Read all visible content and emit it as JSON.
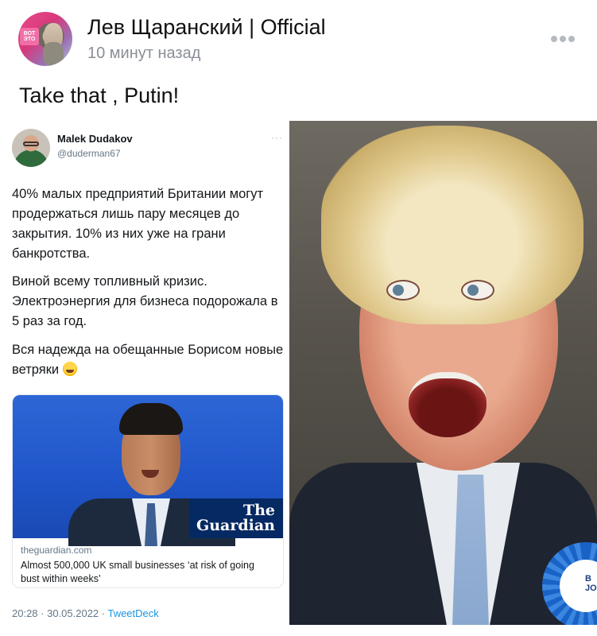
{
  "post": {
    "author": "Лев Щаранский | Official",
    "time": "10 минут назад",
    "text": "Take that , Putin!",
    "avatar_badge": "ВОТ ЭТО",
    "more_icon": "more-horizontal-icon"
  },
  "tweet": {
    "author_name": "Malek Dudakov",
    "author_handle": "@duderman67",
    "more_label": "···",
    "paragraphs": [
      "40% малых предприятий Британии могут продержаться лишь пару месяцев до закрытия. 10% из них уже на грани банкротства.",
      "Виной всему топливный кризис. Электроэнергия для бизнеса подорожала в 5 раз за год.",
      "Вся надежда на обещанные Борисом новые ветряки"
    ],
    "emoji": "laughing-emoji-icon",
    "link_card": {
      "brand_line1": "The",
      "brand_line2": "Guardian",
      "domain": "theguardian.com",
      "title": "Almost 500,000 UK small businesses ‘at risk of going bust within weeks’"
    },
    "meta_time": "20:28 · 30.05.2022 · ",
    "meta_source": "TweetDeck"
  },
  "photo": {
    "rosette_text": "B\nJOH"
  },
  "colors": {
    "link_blue": "#1b95e0",
    "guardian_navy": "#052962",
    "muted_gray": "#8a8f96"
  }
}
